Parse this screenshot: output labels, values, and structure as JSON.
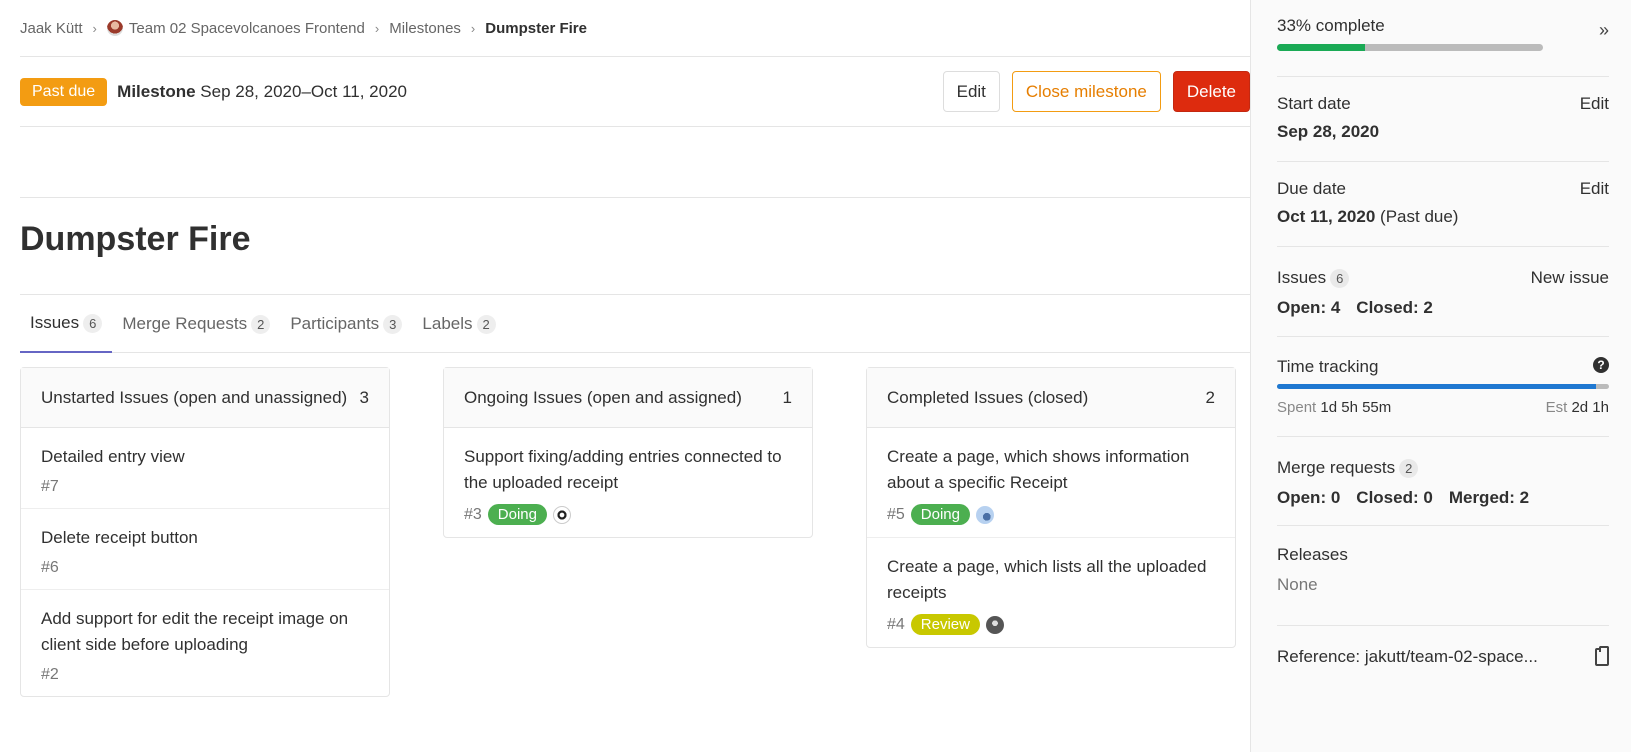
{
  "breadcrumb": {
    "items": [
      "Jaak Kütt",
      "Team 02 Spacevolcanoes Frontend",
      "Milestones"
    ],
    "current": "Dumpster Fire"
  },
  "header": {
    "badge": "Past due",
    "label": "Milestone",
    "dates": "Sep 28, 2020–Oct 11, 2020",
    "edit": "Edit",
    "close": "Close milestone",
    "delete": "Delete"
  },
  "title": "Dumpster Fire",
  "tabs": [
    {
      "label": "Issues",
      "count": "6"
    },
    {
      "label": "Merge Requests",
      "count": "2"
    },
    {
      "label": "Participants",
      "count": "3"
    },
    {
      "label": "Labels",
      "count": "2"
    }
  ],
  "boards": [
    {
      "title": "Unstarted Issues (open and unassigned)",
      "count": "3",
      "cards": [
        {
          "title": "Detailed entry view",
          "ref": "#7"
        },
        {
          "title": "Delete receipt button",
          "ref": "#6"
        },
        {
          "title": "Add support for edit the receipt image on client side before uploading",
          "ref": "#2"
        }
      ]
    },
    {
      "title": "Ongoing Issues (open and assigned)",
      "count": "1",
      "cards": [
        {
          "title": "Support fixing/adding entries connected to the uploaded receipt",
          "ref": "#3",
          "label": "Doing"
        }
      ]
    },
    {
      "title": "Completed Issues (closed)",
      "count": "2",
      "cards": [
        {
          "title": "Create a page, which shows information about a specific Receipt",
          "ref": "#5",
          "label": "Doing"
        },
        {
          "title": "Create a page, which lists all the uploaded receipts",
          "ref": "#4",
          "label": "Review"
        }
      ]
    }
  ],
  "sidebar": {
    "progress_text": "33% complete",
    "progress": 0.33,
    "start_label": "Start date",
    "start_value": "Sep 28, 2020",
    "due_label": "Due date",
    "due_value": "Oct 11, 2020",
    "due_suffix": "(Past due)",
    "edit": "Edit",
    "issues_label": "Issues",
    "issues_count": "6",
    "new_issue": "New issue",
    "issues_open": "Open: 4",
    "issues_closed": "Closed: 2",
    "time_label": "Time tracking",
    "time_progress": 0.96,
    "spent_label": "Spent",
    "spent_value": "1d 5h 55m",
    "est_label": "Est",
    "est_value": "2d 1h",
    "mr_label": "Merge requests",
    "mr_count": "2",
    "mr_open": "Open: 0",
    "mr_closed": "Closed: 0",
    "mr_merged": "Merged: 2",
    "releases_label": "Releases",
    "releases_value": "None",
    "reference": "Reference: jakutt/team-02-space..."
  },
  "colors": {
    "past_due": "#f39c12",
    "danger": "#dd2b0e",
    "doing": "#4caf50",
    "review": "#c8c800",
    "progress": "#1aaa55",
    "time": "#1f78d1"
  }
}
